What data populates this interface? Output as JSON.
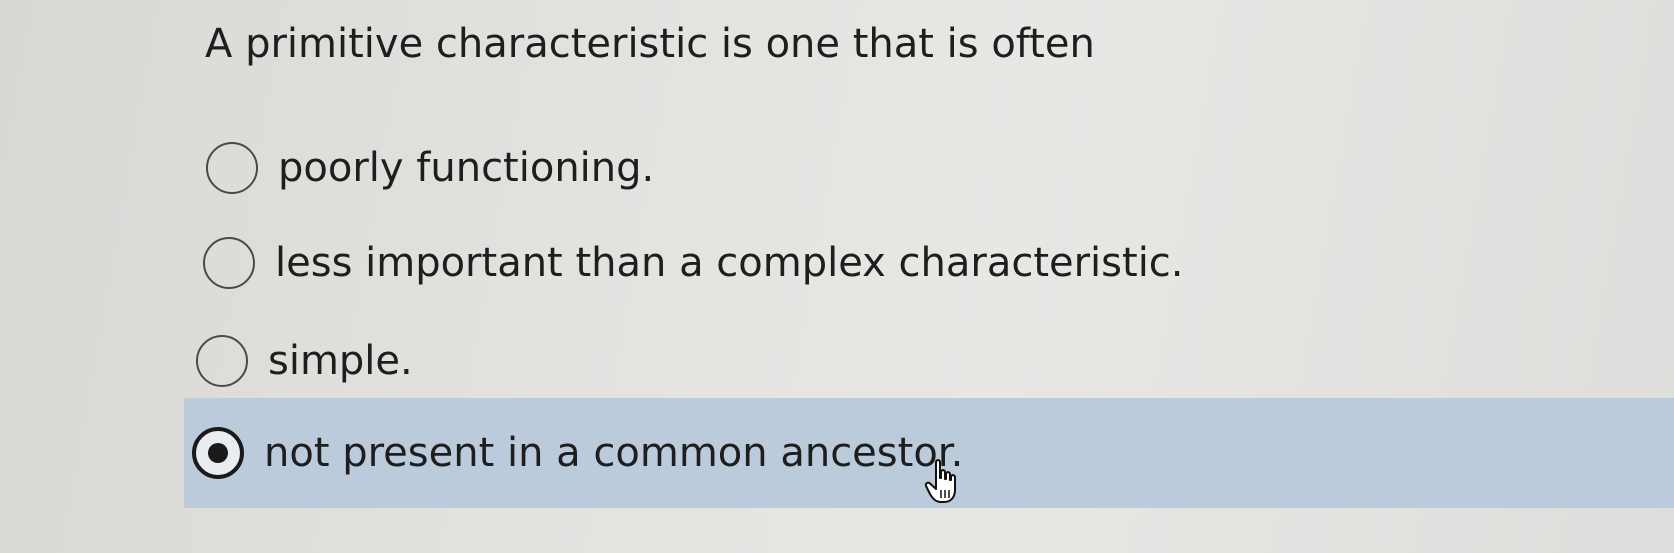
{
  "question": {
    "text": "A primitive characteristic is one that is often"
  },
  "options": [
    {
      "label": "poorly functioning.",
      "selected": false
    },
    {
      "label": "less important than a complex characteristic.",
      "selected": false
    },
    {
      "label": "simple.",
      "selected": false
    },
    {
      "label": "not present in a common ancestor.",
      "selected": true
    }
  ],
  "colors": {
    "selected_background": "#bccbdb",
    "page_background": "#e3e2df",
    "text": "#1e1e1e"
  },
  "icons": {
    "cursor": "hand-pointer-icon"
  }
}
